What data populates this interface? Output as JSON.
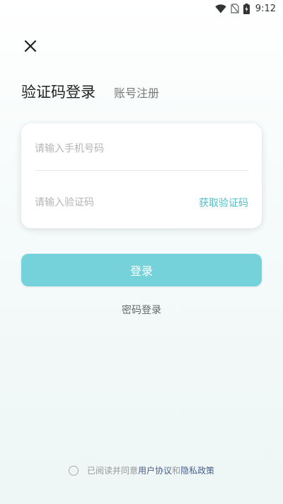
{
  "status_bar": {
    "time": "9:12",
    "icons": [
      "wifi-icon",
      "no-sim-icon",
      "battery-charging-icon"
    ]
  },
  "close_icon": "close-icon",
  "tabs": {
    "active": "验证码登录",
    "inactive": "账号注册"
  },
  "form": {
    "phone_placeholder": "请输入手机号码",
    "code_placeholder": "请输入验证码",
    "get_code_label": "获取验证码"
  },
  "login_button_label": "登录",
  "password_login_label": "密码登录",
  "agreement": {
    "prefix": "已阅读并同意",
    "user_agreement": "用户协议",
    "and": "和",
    "privacy_policy": "隐私政策"
  },
  "colors": {
    "accent": "#75d2da",
    "link_teal": "#4fbfc8",
    "link_blue": "#4a5f8a"
  }
}
